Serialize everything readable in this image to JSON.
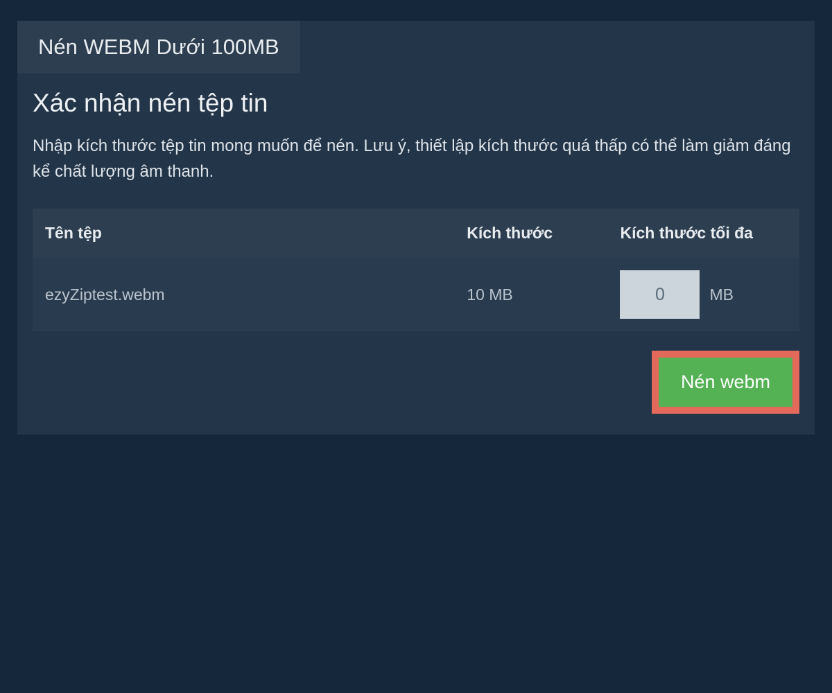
{
  "tab": {
    "label": "Nén WEBM Dưới 100MB"
  },
  "content": {
    "heading": "Xác nhận nén tệp tin",
    "description": "Nhập kích thước tệp tin mong muốn để nén. Lưu ý, thiết lập kích thước quá thấp có thể làm giảm đáng kể chất lượng âm thanh."
  },
  "table": {
    "headers": {
      "filename": "Tên tệp",
      "size": "Kích thước",
      "maxsize": "Kích thước tối đa"
    },
    "row": {
      "filename": "ezyZiptest.webm",
      "size": "10 MB",
      "maxsize_value": "0",
      "maxsize_unit": "MB"
    }
  },
  "button": {
    "compress": "Nén webm"
  }
}
